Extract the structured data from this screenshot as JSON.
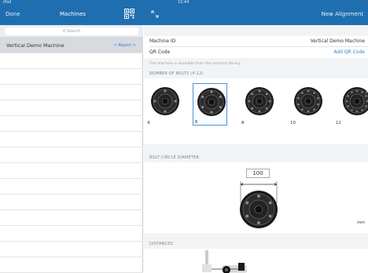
{
  "status": {
    "left": "iPad",
    "time": "10:44",
    "right": ""
  },
  "nav": {
    "back": "Done",
    "title": "Machines",
    "new_alignment": "New Alignment"
  },
  "search": {
    "placeholder": "Q Search"
  },
  "machines": [
    {
      "name": "Vertical Demo Machine",
      "action": "< Report >",
      "selected": true
    }
  ],
  "details": {
    "machine_id_label": "Machine ID",
    "machine_id_value": "Vertical Demo Machine",
    "qr_label": "QR Code",
    "qr_action": "Add QR Code",
    "hint": "The machine is available from the machine library.",
    "bolts_section": "NUMBER OF BOLTS (4-12)",
    "bolt_options": [
      "4",
      "6",
      "8",
      "10",
      "12"
    ],
    "bolt_selected": "6",
    "diameter_section": "BOLT CIRCLE DIAMETER",
    "diameter_value": "100",
    "unit": "mm",
    "distances_section": "DISTANCES"
  },
  "colors": {
    "nav": "#1f6fb0",
    "accent": "#2f7ed8",
    "selected_row": "#d7dbe0"
  }
}
